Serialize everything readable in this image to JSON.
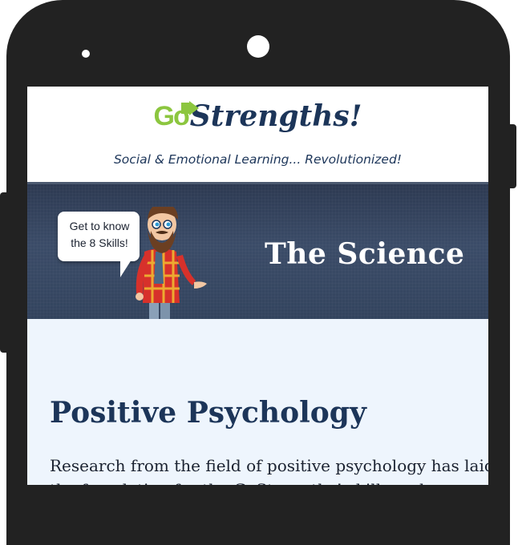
{
  "header": {
    "logo_go": "Go",
    "logo_strengths": "Strengths!",
    "tagline": "Social & Emotional Learning... Revolutionized!"
  },
  "banner": {
    "title": "The Science",
    "bubble_text": "Get to know the 8 Skills!"
  },
  "content": {
    "heading": "Positive Psychology",
    "body": "Research from the field of positive psychology has laid the foundation for the GoStrengths! skills and on..."
  },
  "colors": {
    "brand_green": "#8cc63f",
    "brand_navy": "#1c3559",
    "banner_bg": "#34445e",
    "content_bg": "#eef5fd"
  }
}
